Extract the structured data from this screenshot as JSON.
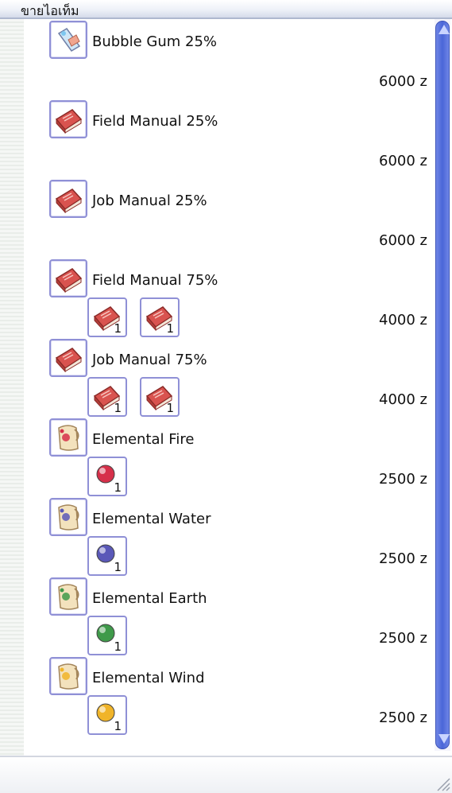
{
  "window": {
    "title": "ขายไอเท็ม"
  },
  "items": [
    {
      "name": "Bubble Gum 25%",
      "price": "6000 z",
      "icon": "bubble-gum-icon",
      "materials": []
    },
    {
      "name": "Field Manual 25%",
      "price": "6000 z",
      "icon": "manual-book-icon",
      "materials": []
    },
    {
      "name": "Job Manual 25%",
      "price": "6000 z",
      "icon": "manual-book-icon",
      "materials": []
    },
    {
      "name": "Field Manual 75%",
      "price": "4000 z",
      "icon": "manual-book-icon",
      "materials": [
        {
          "icon": "manual-book-icon",
          "count": "1"
        },
        {
          "icon": "manual-book-icon",
          "count": "1"
        }
      ]
    },
    {
      "name": "Job Manual 75%",
      "price": "4000 z",
      "icon": "manual-book-icon",
      "materials": [
        {
          "icon": "manual-book-icon",
          "count": "1"
        },
        {
          "icon": "manual-book-icon",
          "count": "1"
        }
      ]
    },
    {
      "name": "Elemental Fire",
      "price": "2500 z",
      "icon": "scroll-fire-icon",
      "materials": [
        {
          "icon": "fire-orb-icon",
          "count": "1"
        }
      ]
    },
    {
      "name": "Elemental Water",
      "price": "2500 z",
      "icon": "scroll-water-icon",
      "materials": [
        {
          "icon": "water-orb-icon",
          "count": "1"
        }
      ]
    },
    {
      "name": "Elemental Earth",
      "price": "2500 z",
      "icon": "scroll-earth-icon",
      "materials": [
        {
          "icon": "earth-orb-icon",
          "count": "1"
        }
      ]
    },
    {
      "name": "Elemental Wind",
      "price": "2500 z",
      "icon": "scroll-wind-icon",
      "materials": [
        {
          "icon": "wind-orb-icon",
          "count": "1"
        }
      ]
    }
  ],
  "colors": {
    "book": "#d9534f",
    "fire": "#d6304a",
    "water": "#5a58b8",
    "earth": "#3f9a4a",
    "wind": "#f0b429",
    "scrollbar": "#4a66d8"
  }
}
